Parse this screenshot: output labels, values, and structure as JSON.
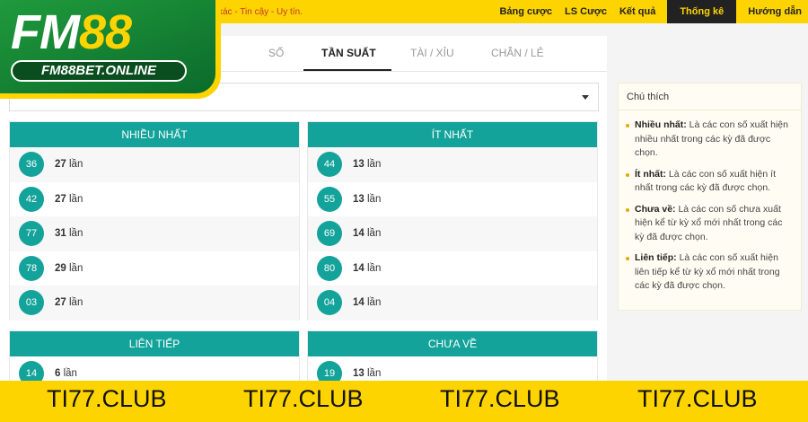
{
  "header": {
    "slogan": "xác - Tin cậy - Uy tín.",
    "nav": [
      {
        "label": "Bảng cược",
        "active": false
      },
      {
        "label": "LS Cược",
        "active": false
      },
      {
        "label": "Kết quả",
        "active": false
      },
      {
        "label": "Thống kê",
        "active": true
      },
      {
        "label": "Hướng dẫn",
        "active": false
      }
    ]
  },
  "logo": {
    "part1": "FM",
    "part2": "88",
    "sub": "FM88BET.ONLINE"
  },
  "tabs": [
    {
      "label": "SỐ",
      "active": false
    },
    {
      "label": "TẦN SUẤT",
      "active": true
    },
    {
      "label": "TÀI / XỈU",
      "active": false
    },
    {
      "label": "CHẴN / LẺ",
      "active": false
    }
  ],
  "select": {
    "value": ""
  },
  "cards": {
    "most": {
      "title": "NHIỀU NHẤT",
      "rows": [
        {
          "number": "36",
          "count": "27",
          "unit": "lần"
        },
        {
          "number": "42",
          "count": "27",
          "unit": "lần"
        },
        {
          "number": "77",
          "count": "31",
          "unit": "lần"
        },
        {
          "number": "78",
          "count": "29",
          "unit": "lần"
        },
        {
          "number": "03",
          "count": "27",
          "unit": "lần"
        }
      ]
    },
    "least": {
      "title": "ÍT NHẤT",
      "rows": [
        {
          "number": "44",
          "count": "13",
          "unit": "lần"
        },
        {
          "number": "55",
          "count": "13",
          "unit": "lần"
        },
        {
          "number": "69",
          "count": "14",
          "unit": "lần"
        },
        {
          "number": "80",
          "count": "14",
          "unit": "lần"
        },
        {
          "number": "04",
          "count": "14",
          "unit": "lần"
        }
      ]
    },
    "consecutive": {
      "title": "LIÊN TIẾP",
      "rows": [
        {
          "number": "14",
          "count": "6",
          "unit": "lần"
        }
      ]
    },
    "missing": {
      "title": "CHƯA VỀ",
      "rows": [
        {
          "number": "19",
          "count": "13",
          "unit": "lần"
        }
      ]
    }
  },
  "legend": {
    "title": "Chú thích",
    "items": [
      {
        "term": "Nhiều nhất:",
        "text": " Là các con số xuất hiện nhiều nhất trong các kỳ đã được chọn."
      },
      {
        "term": "Ít nhất:",
        "text": " Là các con số xuất hiện ít nhất trong các kỳ đã được chọn."
      },
      {
        "term": "Chưa về:",
        "text": " Là các con số chưa xuất hiện kể từ kỳ xổ mới nhất trong các kỳ đã được chọn."
      },
      {
        "term": "Liên tiếp:",
        "text": " Là các con số xuất hiện liên tiếp kể từ kỳ xổ mới nhất trong các kỳ đã được chọn."
      }
    ]
  },
  "watermark": [
    "TI77.CLUB",
    "TI77.CLUB",
    "TI77.CLUB",
    "TI77.CLUB"
  ]
}
